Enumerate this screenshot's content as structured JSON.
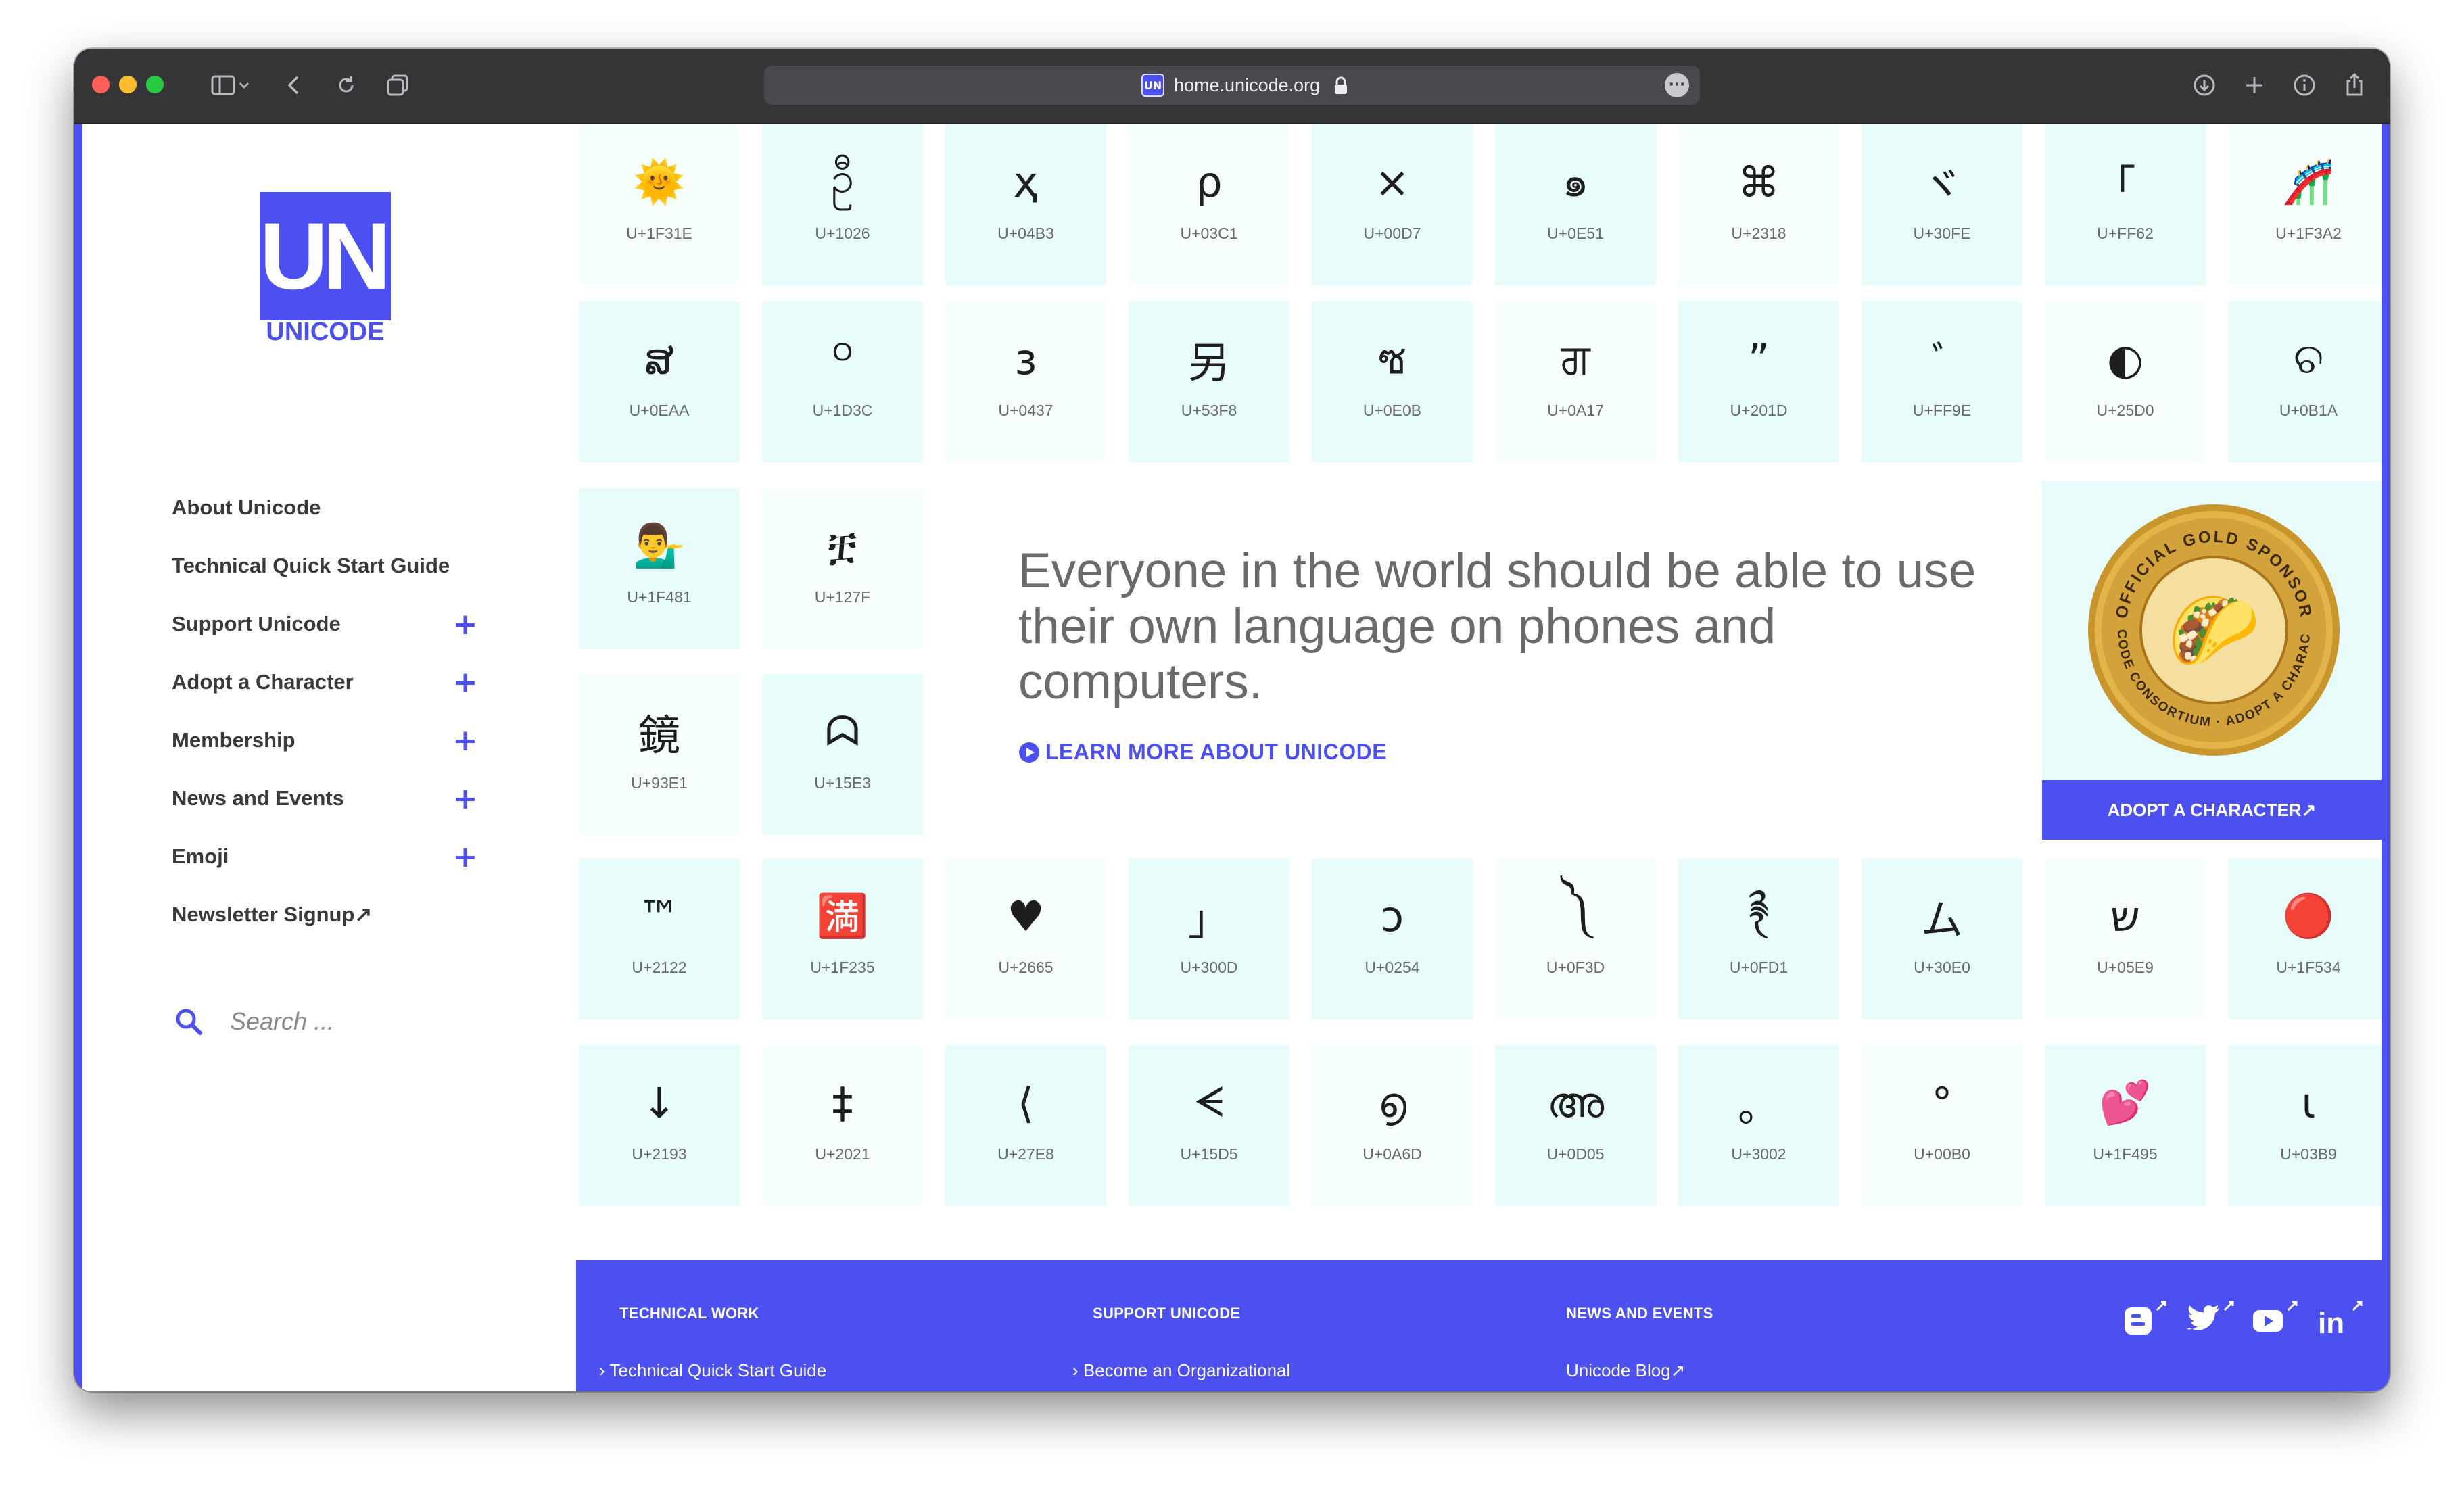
{
  "browser": {
    "url": "home.unicode.org",
    "favicon": "UN"
  },
  "logo": {
    "mark": "UNi",
    "wordmark": "UNICODE"
  },
  "nav": {
    "items": [
      {
        "label": "About Unicode",
        "expandable": false
      },
      {
        "label": "Technical Quick Start Guide",
        "expandable": false
      },
      {
        "label": "Support Unicode",
        "expandable": true
      },
      {
        "label": "Adopt a Character",
        "expandable": true
      },
      {
        "label": "Membership",
        "expandable": true
      },
      {
        "label": "News and Events",
        "expandable": true
      },
      {
        "label": "Emoji",
        "expandable": true
      },
      {
        "label": "Newsletter Signup↗",
        "expandable": false
      }
    ],
    "plus_symbol": "+"
  },
  "search": {
    "placeholder": "Search ..."
  },
  "tiles": {
    "row1": [
      {
        "glyph": "🌞",
        "code": "U+1F31E"
      },
      {
        "glyph": "ဦ",
        "code": "U+1026"
      },
      {
        "glyph": "ҳ",
        "code": "U+04B3"
      },
      {
        "glyph": "ρ",
        "code": "U+03C1"
      },
      {
        "glyph": "×",
        "code": "U+00D7"
      },
      {
        "glyph": "๑",
        "code": "U+0E51"
      },
      {
        "glyph": "⌘",
        "code": "U+2318"
      },
      {
        "glyph": "ヾ",
        "code": "U+30FE"
      },
      {
        "glyph": "｢",
        "code": "U+FF62"
      },
      {
        "glyph": "🎢",
        "code": "U+1F3A2"
      }
    ],
    "row2": [
      {
        "glyph": "ສ",
        "code": "U+0EAA"
      },
      {
        "glyph": "ᴼ",
        "code": "U+1D3C"
      },
      {
        "glyph": "з",
        "code": "U+0437"
      },
      {
        "glyph": "另",
        "code": "U+53F8"
      },
      {
        "glyph": "ซ",
        "code": "U+0E0B"
      },
      {
        "glyph": "ਗ",
        "code": "U+0A17"
      },
      {
        "glyph": "”",
        "code": "U+201D"
      },
      {
        "glyph": "ﾞ",
        "code": "U+FF9E"
      },
      {
        "glyph": "◐",
        "code": "U+25D0"
      },
      {
        "glyph": "ଚ",
        "code": "U+0B1A"
      }
    ],
    "row3": [
      {
        "glyph": "💁‍♂️",
        "code": "U+1F481"
      },
      {
        "glyph": "ቿ",
        "code": "U+127F"
      }
    ],
    "row4": [
      {
        "glyph": "鏡",
        "code": "U+93E1"
      },
      {
        "glyph": "ᗣ",
        "code": "U+15E3"
      }
    ],
    "row5": [
      {
        "glyph": "™",
        "code": "U+2122"
      },
      {
        "glyph": "🈵",
        "code": "U+1F235"
      },
      {
        "glyph": "♥",
        "code": "U+2665"
      },
      {
        "glyph": "」",
        "code": "U+300D"
      },
      {
        "glyph": "ɔ",
        "code": "U+0254"
      },
      {
        "glyph": "༽",
        "code": "U+0F3D"
      },
      {
        "glyph": "࿑",
        "code": "U+0FD1"
      },
      {
        "glyph": "ム",
        "code": "U+30E0"
      },
      {
        "glyph": "ש",
        "code": "U+05E9"
      },
      {
        "glyph": "🔴",
        "code": "U+1F534"
      }
    ],
    "row6": [
      {
        "glyph": "↓",
        "code": "U+2193"
      },
      {
        "glyph": "‡",
        "code": "U+2021"
      },
      {
        "glyph": "⟨",
        "code": "U+27E8"
      },
      {
        "glyph": "ᗕ",
        "code": "U+15D5"
      },
      {
        "glyph": "൭",
        "code": "U+0A6D"
      },
      {
        "glyph": "അ",
        "code": "U+0D05"
      },
      {
        "glyph": "。",
        "code": "U+3002"
      },
      {
        "glyph": "°",
        "code": "U+00B0"
      },
      {
        "glyph": "💕",
        "code": "U+1F495"
      },
      {
        "glyph": "ι",
        "code": "U+03B9"
      }
    ]
  },
  "hero": {
    "text": "Everyone in the world should be able to use their own language on phones and computers.",
    "link_label": "LEARN MORE ABOUT UNICODE"
  },
  "sponsor": {
    "badge_top": "OFFICIAL GOLD SPONSOR",
    "badge_bottom": "UNICODE CONSORTIUM · ADOPT A CHARACTER",
    "badge_emoji": "🌮",
    "button_label": "ADOPT A CHARACTER↗"
  },
  "footer": {
    "columns": [
      {
        "heading": "TECHNICAL WORK",
        "first_link": "› Technical Quick Start Guide"
      },
      {
        "heading": "SUPPORT UNICODE",
        "first_link": "› Become an Organizational"
      },
      {
        "heading": "NEWS AND EVENTS",
        "first_link": "Unicode Blog↗"
      }
    ],
    "social": [
      {
        "icon": "blogger-icon",
        "label": "B"
      },
      {
        "icon": "twitter-icon",
        "label": "t"
      },
      {
        "icon": "youtube-icon",
        "label": "▶"
      },
      {
        "icon": "linkedin-icon",
        "label": "in"
      }
    ]
  },
  "colors": {
    "brand": "#4d50f0",
    "tile_bg": "#e9fcfc",
    "titlebar": "#353538"
  }
}
